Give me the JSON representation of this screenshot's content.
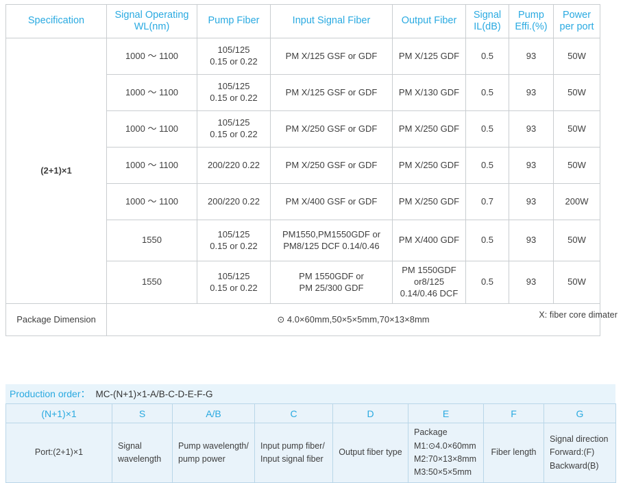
{
  "spec_table": {
    "headers": [
      "Specification",
      "Signal Operating\nWL(nm)",
      "Pump Fiber",
      "Input Signal Fiber",
      "Output Fiber",
      "Signal\nIL(dB)",
      "Pump\nEffi.(%)",
      "Power\nper port"
    ],
    "headers_parts": {
      "h0": "Specification",
      "h1a": "Signal Operating",
      "h1b": "WL(nm)",
      "h2": "Pump Fiber",
      "h3": "Input Signal Fiber",
      "h4": "Output Fiber",
      "h5a": "Signal",
      "h5b": "IL(dB)",
      "h6a": "Pump",
      "h6b": "Effi.(%)",
      "h7a": "Power",
      "h7b": "per port"
    },
    "specification_label": "(2+1)×1",
    "rows": [
      {
        "wl": "1000 ～ 1100",
        "pump_a": "105/125",
        "pump_b": "0.15 or 0.22",
        "input_a": "PM X/125 GSF or GDF",
        "input_b": "",
        "output_a": "PM X/125 GDF",
        "output_b": "",
        "output_c": "",
        "il": "0.5",
        "effi": "93",
        "power": "50W"
      },
      {
        "wl": "1000 ～ 1100",
        "pump_a": "105/125",
        "pump_b": "0.15 or 0.22",
        "input_a": "PM X/125 GSF or GDF",
        "input_b": "",
        "output_a": "PM X/130 GDF",
        "output_b": "",
        "output_c": "",
        "il": "0.5",
        "effi": "93",
        "power": "50W"
      },
      {
        "wl": "1000 ～ 1100",
        "pump_a": "105/125",
        "pump_b": "0.15 or 0.22",
        "input_a": "PM X/250 GSF or GDF",
        "input_b": "",
        "output_a": "PM X/250 GDF",
        "output_b": "",
        "output_c": "",
        "il": "0.5",
        "effi": "93",
        "power": "50W"
      },
      {
        "wl": "1000 ～ 1100",
        "pump_a": "200/220   0.22",
        "pump_b": "",
        "input_a": "PM X/250 GSF or GDF",
        "input_b": "",
        "output_a": "PM X/250 GDF",
        "output_b": "",
        "output_c": "",
        "il": "0.5",
        "effi": "93",
        "power": "50W"
      },
      {
        "wl": "1000 ～ 1100",
        "pump_a": "200/220   0.22",
        "pump_b": "",
        "input_a": "PM X/400 GSF or GDF",
        "input_b": "",
        "output_a": "PM X/250 GDF",
        "output_b": "",
        "output_c": "",
        "il": "0.7",
        "effi": "93",
        "power": "200W"
      },
      {
        "wl": "1550",
        "pump_a": "105/125",
        "pump_b": "0.15 or 0.22",
        "input_a": "PM1550,PM1550GDF or",
        "input_b": "PM8/125 DCF 0.14/0.46",
        "output_a": "PM X/400 GDF",
        "output_b": "",
        "output_c": "",
        "il": "0.5",
        "effi": "93",
        "power": "50W"
      },
      {
        "wl": "1550",
        "pump_a": "105/125",
        "pump_b": "0.15 or 0.22",
        "input_a": "PM 1550GDF or",
        "input_b": "PM 25/300 GDF",
        "output_a": "PM 1550GDF",
        "output_b": "or8/125",
        "output_c": "0.14/0.46 DCF",
        "il": "0.5",
        "effi": "93",
        "power": "50W"
      }
    ],
    "package_dimension_label": "Package Dimension",
    "package_dimension_value": "⊙ 4.0×60mm,50×5×5mm,70×13×8mm"
  },
  "fiber_note": "X:  fiber core dimater",
  "order_section": {
    "title_label": "Production order：",
    "title_code": "MC-(N+1)×1-A/B-C-D-E-F-G",
    "headers": [
      "(N+1)×1",
      "S",
      "A/B",
      "C",
      "D",
      "E",
      "F",
      "G"
    ],
    "cells": {
      "port": "Port:(2+1)×1",
      "s_line1": "Signal",
      "s_line2": "wavelength",
      "ab_line1": "Pump wavelength/",
      "ab_line2": "pump power",
      "c_line1": "Input pump fiber/",
      "c_line2": "Input signal fiber",
      "d_line1": "Output fiber type",
      "e_line1": "Package",
      "e_line2": "M1:⊙4.0×60mm",
      "e_line3": "M2:70×13×8mm",
      "e_line4": "M3:50×5×5mm",
      "f_line1": "Fiber length",
      "g_line1": "Signal direction",
      "g_line2": "Forward:(F)",
      "g_line3": "Backward(B)"
    }
  },
  "colors": {
    "header_blue": "#2aaae1",
    "order_bg": "#e9f3fa",
    "order_border": "#b9d6e8",
    "spec_border": "#c9cdd0"
  }
}
